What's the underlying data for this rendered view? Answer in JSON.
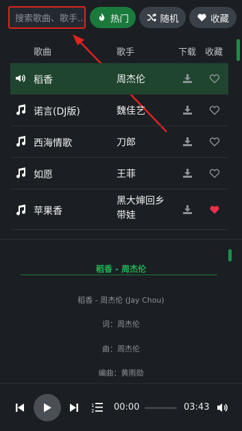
{
  "search": {
    "placeholder": "搜索歌曲、歌手..."
  },
  "buttons": {
    "hot": "热门",
    "random": "随机",
    "favorites": "收藏"
  },
  "table": {
    "headers": {
      "song": "歌曲",
      "artist": "歌手",
      "download": "下载",
      "favorite": "收藏"
    },
    "rows": [
      {
        "title": "稻香",
        "artist": "周杰伦",
        "playing": true,
        "favorited": false
      },
      {
        "title": "诺言(DJ版)",
        "artist": "魏佳艺",
        "playing": false,
        "favorited": false
      },
      {
        "title": "西海情歌",
        "artist": "刀郎",
        "playing": false,
        "favorited": false
      },
      {
        "title": "如愿",
        "artist": "王菲",
        "playing": false,
        "favorited": false
      },
      {
        "title": "苹果香",
        "artist": "黑大婶回乡带娃",
        "playing": false,
        "favorited": true
      }
    ]
  },
  "lyrics": {
    "title": "稻香 - 周杰伦",
    "lines": [
      "稻香 - 周杰伦 (Jay Chou)",
      "词：周杰伦",
      "曲：周杰伦",
      "编曲：黄雨勋"
    ]
  },
  "player": {
    "current_time": "00:00",
    "total_time": "03:43",
    "progress": 0
  },
  "colors": {
    "accent": "#1a7a3c",
    "active_row": "#20452f",
    "fav_red": "#e8304a",
    "highlight_box": "#e0231f"
  },
  "icons": [
    "fire-icon",
    "shuffle-icon",
    "heart-icon",
    "speaker-icon",
    "music-note-icon",
    "download-icon",
    "prev-icon",
    "play-icon",
    "next-icon",
    "playlist-icon",
    "volume-icon"
  ]
}
